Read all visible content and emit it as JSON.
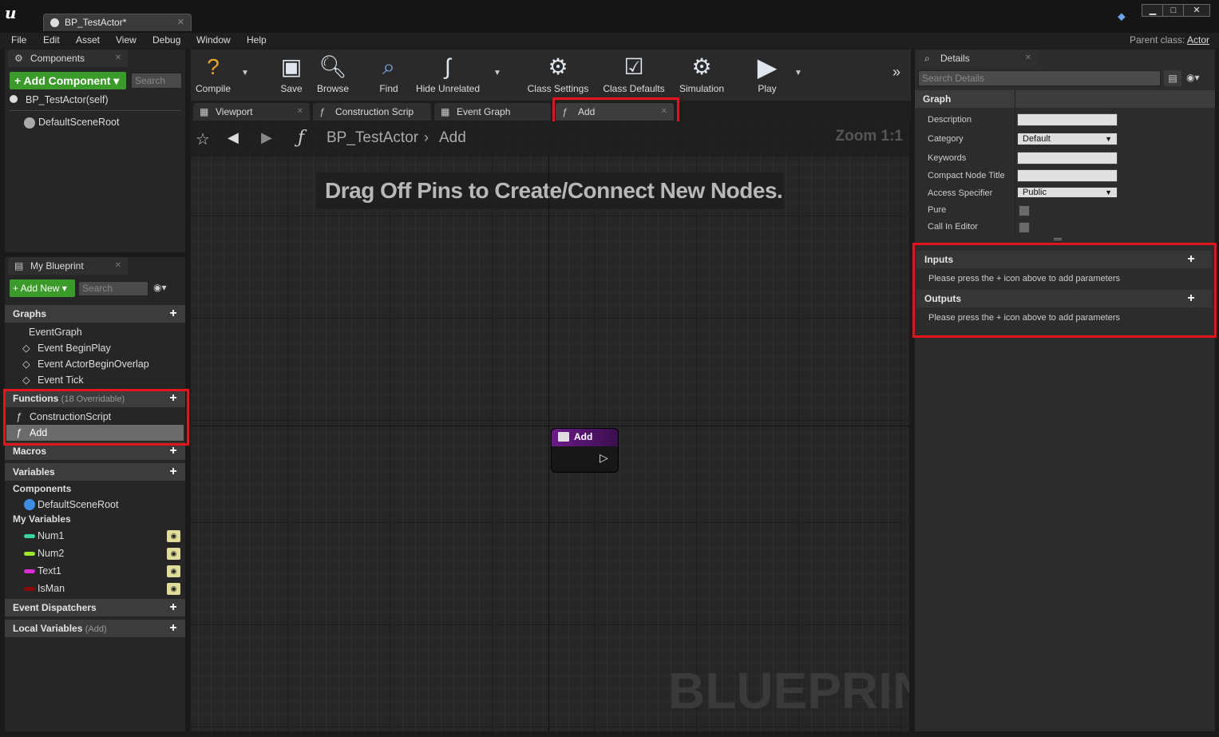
{
  "window": {
    "doc_tab": "BP_TestActor*",
    "minimize": "▁",
    "maximize": "□",
    "close": "✕"
  },
  "menu": [
    "File",
    "Edit",
    "Asset",
    "View",
    "Debug",
    "Window",
    "Help"
  ],
  "parent_class": {
    "label": "Parent class:",
    "value": "Actor"
  },
  "components_panel": {
    "tab": "Components",
    "add_button": "+ Add Component ▾",
    "search_placeholder": "Search",
    "self_item": "BP_TestActor(self)",
    "root_item": "DefaultSceneRoot"
  },
  "my_blueprint": {
    "tab": "My Blueprint",
    "add_new": "+ Add New ▾",
    "search_placeholder": "Search",
    "graphs": {
      "header": "Graphs",
      "event_graph": "EventGraph",
      "events": [
        "Event BeginPlay",
        "Event ActorBeginOverlap",
        "Event Tick"
      ]
    },
    "functions": {
      "header": "Functions",
      "sub": "(18 Overridable)",
      "items": [
        "ConstructionScript",
        "Add"
      ]
    },
    "macros": "Macros",
    "variables": {
      "header": "Variables",
      "components_header": "Components",
      "components_item": "DefaultSceneRoot",
      "my_vars_header": "My Variables",
      "items": [
        {
          "name": "Num1",
          "color": "#39d6a5"
        },
        {
          "name": "Num2",
          "color": "#9ee82a"
        },
        {
          "name": "Text1",
          "color": "#dd2bd8"
        },
        {
          "name": "IsMan",
          "color": "#8c0a0a"
        }
      ]
    },
    "event_dispatchers": "Event Dispatchers",
    "local_variables": {
      "header": "Local Variables",
      "sub": "(Add)"
    }
  },
  "toolbar": [
    {
      "label": "Compile",
      "icon": "compile-icon"
    },
    {
      "label": "Save",
      "icon": "save-icon"
    },
    {
      "label": "Browse",
      "icon": "browse-icon"
    },
    {
      "label": "Find",
      "icon": "find-icon"
    },
    {
      "label": "Hide Unrelated",
      "icon": "hide-unrelated-icon"
    },
    {
      "label": "Class Settings",
      "icon": "class-settings-icon"
    },
    {
      "label": "Class Defaults",
      "icon": "class-defaults-icon"
    },
    {
      "label": "Simulation",
      "icon": "simulation-icon"
    },
    {
      "label": "Play",
      "icon": "play-icon"
    }
  ],
  "editor_tabs": [
    "Viewport",
    "Construction Scrip",
    "Event Graph",
    "Add"
  ],
  "graph": {
    "breadcrumb_root": "BP_TestActor",
    "breadcrumb_current": "Add",
    "zoom": "Zoom 1:1",
    "hint": "Drag Off Pins to Create/Connect New Nodes.",
    "node_title": "Add",
    "watermark": "BLUEPRINT"
  },
  "details": {
    "tab": "Details",
    "search_placeholder": "Search Details",
    "graph_header": "Graph",
    "rows": {
      "description": "Description",
      "category": "Category",
      "category_value": "Default",
      "keywords": "Keywords",
      "compact_title": "Compact Node Title",
      "access": "Access Specifier",
      "access_value": "Public",
      "pure": "Pure",
      "call_in_editor": "Call In Editor"
    },
    "inputs": {
      "header": "Inputs",
      "hint": "Please press the + icon above to add parameters"
    },
    "outputs": {
      "header": "Outputs",
      "hint": "Please press the + icon above to add parameters"
    }
  },
  "colors": {
    "highlight": "#e3141e",
    "node_header": "#5a1a78",
    "green_button": "#3b9b2a"
  }
}
